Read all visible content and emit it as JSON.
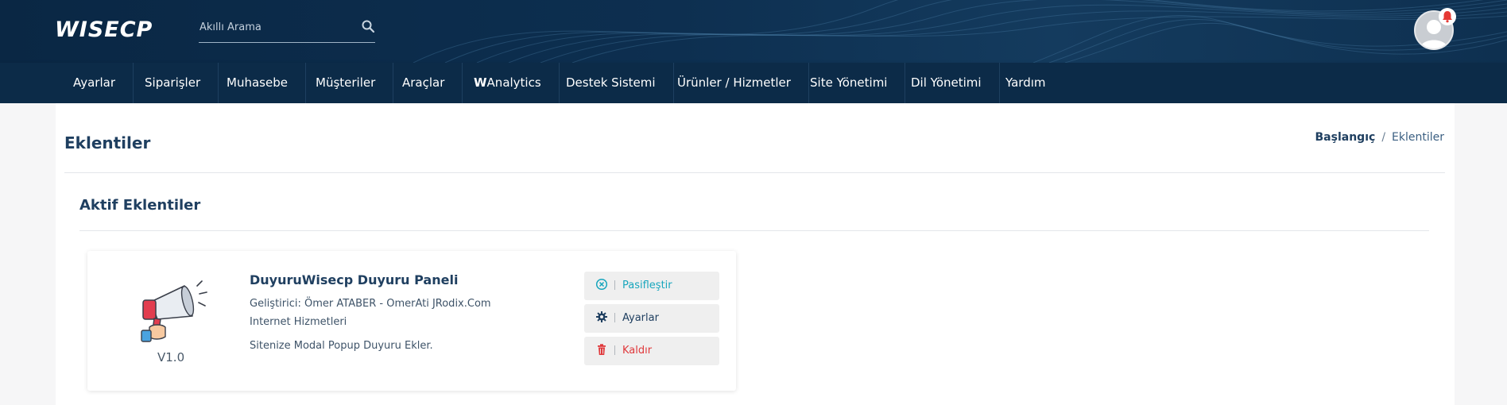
{
  "header": {
    "logo": "WISECP",
    "search_placeholder": "Akıllı Arama"
  },
  "nav": {
    "items": [
      {
        "label": "Ayarlar"
      },
      {
        "label": "Siparişler"
      },
      {
        "label": "Muhasebe"
      },
      {
        "label": "Müşteriler"
      },
      {
        "label": "Araçlar"
      },
      {
        "label_bold": "W",
        "label": "Analytics"
      },
      {
        "label": "Destek Sistemi"
      },
      {
        "label": "Ürünler / Hizmetler"
      },
      {
        "label": "Site Yönetimi"
      },
      {
        "label": "Dil Yönetimi"
      },
      {
        "label": "Yardım"
      }
    ]
  },
  "page": {
    "title": "Eklentiler",
    "breadcrumb": {
      "home": "Başlangıç",
      "separator": "/",
      "current": "Eklentiler"
    },
    "section_title": "Aktif Eklentiler"
  },
  "plugin": {
    "name": "DuyuruWisecp Duyuru Paneli",
    "developer": "Geliştirici: Ömer ATABER - OmerAti JRodix.Com Internet Hizmetleri",
    "description": "Sitenize Modal Popup Duyuru Ekler.",
    "version": "V1.0",
    "buttons": {
      "deactivate": "Pasifleştir",
      "settings": "Ayarlar",
      "remove": "Kaldır"
    }
  },
  "colors": {
    "header_bg": "#0c2b48",
    "accent_teal": "#18a6bd",
    "danger": "#e0383b",
    "title": "#1f3f60"
  },
  "icons": {
    "search": "search-icon",
    "bell": "bell-icon",
    "avatar": "avatar",
    "deactivate": "circle-x-icon",
    "settings": "gear-icon",
    "remove": "trash-icon",
    "plugin": "megaphone-icon"
  }
}
